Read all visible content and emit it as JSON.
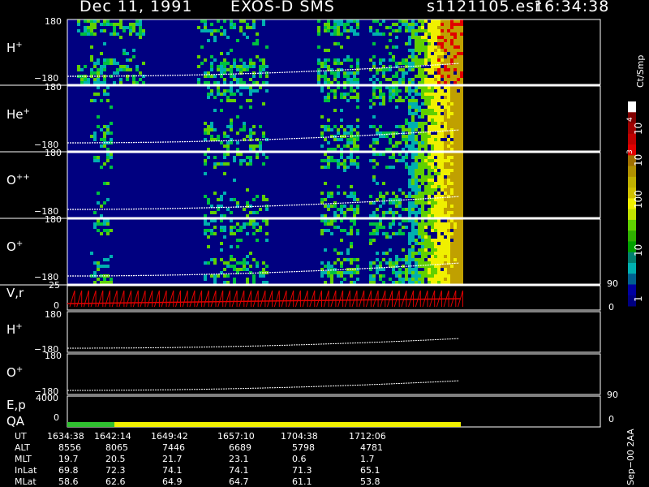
{
  "header": {
    "date": "Dec 11, 1991",
    "instrument": "EXOS-D SMS",
    "file": "s1121105.esr",
    "time": "16:34:38"
  },
  "panels": [
    {
      "label": "H",
      "sup": "+",
      "ymax": "180",
      "ymin": "−180"
    },
    {
      "label": "He",
      "sup": "+",
      "ymax": "180",
      "ymin": "−180"
    },
    {
      "label": "O",
      "sup": "++",
      "ymax": "180",
      "ymin": "−180"
    },
    {
      "label": "O",
      "sup": "+",
      "ymax": "180",
      "ymin": "−180"
    }
  ],
  "line_panels": {
    "vr": {
      "label": "V,r",
      "ymax": "25",
      "ymin": "0",
      "right_top": "90",
      "right_bottom": "0"
    },
    "h": {
      "label": "H",
      "sup": "+",
      "ymax": "180",
      "ymin": "−180"
    },
    "o": {
      "label": "O",
      "sup": "+",
      "ymax": "180",
      "ymin": "−180"
    },
    "ep": {
      "label": "E,p",
      "ymax": "4000",
      "right_top": "90"
    },
    "qa": {
      "label": "QA",
      "ymin": "0",
      "right_bottom": "0"
    }
  },
  "colorbar": {
    "unit": "Ct/Smp",
    "labels": [
      "10",
      "4",
      "10",
      "3",
      "100",
      "10",
      "1"
    ],
    "levels_meaning": "log count scale 1 to 10^4"
  },
  "footer_right": "Sep−00  2AA",
  "ephemeris": {
    "rows": [
      {
        "name": "UT",
        "values": [
          "1634:38",
          "1642:14",
          "1649:42",
          "1657:10",
          "1704:38",
          "1712:06"
        ]
      },
      {
        "name": "ALT",
        "values": [
          "8556",
          "8065",
          "7446",
          "6689",
          "5798",
          "4781"
        ]
      },
      {
        "name": "MLT",
        "values": [
          "19.7",
          "20.5",
          "21.7",
          "23.1",
          "0.6",
          "1.7"
        ]
      },
      {
        "name": "InLat",
        "values": [
          "69.8",
          "72.3",
          "74.1",
          "74.1",
          "71.3",
          "65.1"
        ]
      },
      {
        "name": "MLat",
        "values": [
          "58.6",
          "62.6",
          "64.9",
          "64.7",
          "61.1",
          "53.8"
        ]
      }
    ]
  },
  "chart_data": {
    "type": "heatmap",
    "title": "Dec 11, 1991 EXOS-D SMS",
    "x_ticks": [
      "1634:38",
      "1642:14",
      "1649:42",
      "1657:10",
      "1704:38",
      "1712:06"
    ],
    "ylim": [
      -180,
      180
    ],
    "series": [
      {
        "name": "H+"
      },
      {
        "name": "He+"
      },
      {
        "name": "O++"
      },
      {
        "name": "O+"
      }
    ],
    "colorscale": {
      "min": 1,
      "max": 10000,
      "log": true
    },
    "colors": [
      "#000080",
      "#00b0b0",
      "#00c040",
      "#60d000",
      "#f0f000",
      "#c0a000",
      "#e00000",
      "#800000",
      "#ffffff"
    ]
  }
}
